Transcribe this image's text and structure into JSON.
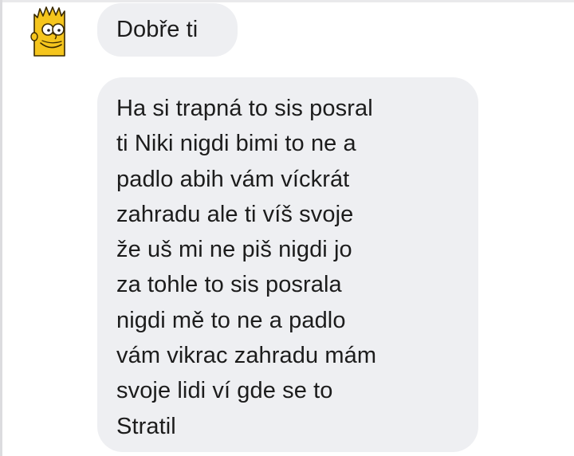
{
  "conversation": {
    "messages": [
      {
        "text": "Dobře ti"
      },
      {
        "text": "Ha si trapná to sis posral\nti Niki nigdi bimi to ne a\npadlo abih vám víckrát\nzahradu  ale ti víš svoje\nže  uš mi ne piš nigdi jo\nza tohle to sis posrala\nnigdi mě to ne a padlo\nvám vikrac zahradu mám\nsvoje lidi ví gde se to\nStratil"
      }
    ],
    "sender": {
      "avatar_icon": "bart-simpson-avatar-icon"
    }
  },
  "colors": {
    "bubble_background": "#eeeff2",
    "text": "#1c1c1c",
    "avatar_skin": "#f5c51d"
  }
}
